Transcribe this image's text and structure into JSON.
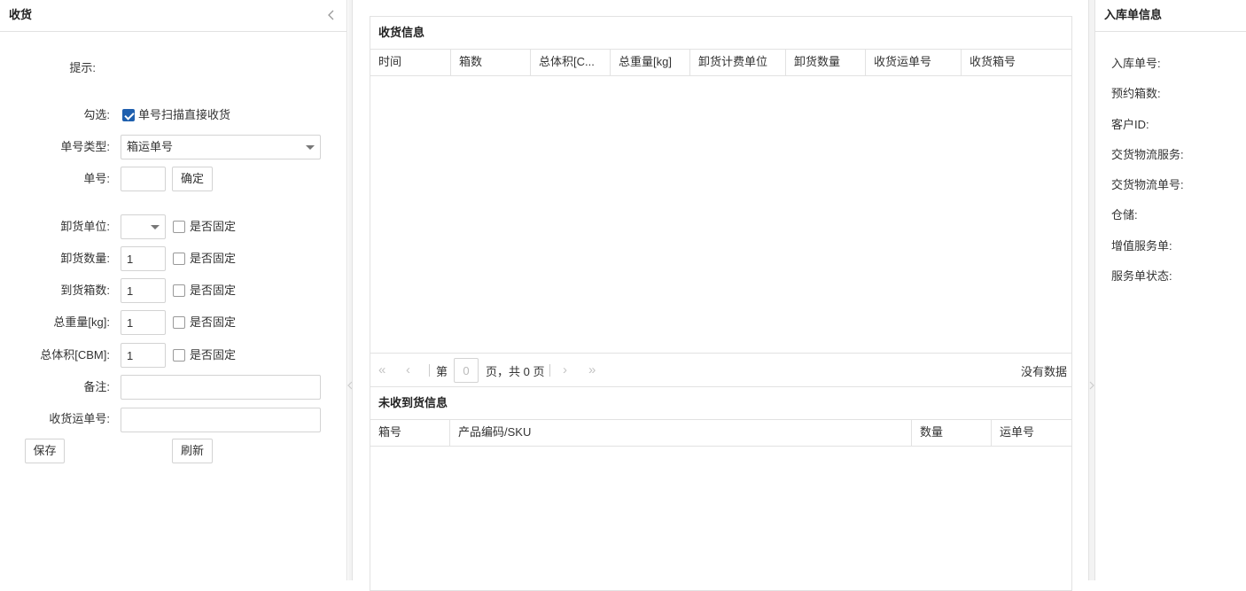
{
  "left": {
    "title": "收货",
    "hint_label": "提示:",
    "check_label": "勾选:",
    "scan_direct_label": "单号扫描直接收货",
    "scan_direct_checked": true,
    "type_label": "单号类型:",
    "type_value": "箱运单号",
    "number_label": "单号:",
    "number_value": "",
    "confirm_btn": "确定",
    "unload_unit_label": "卸货单位:",
    "unload_qty_label": "卸货数量:",
    "unload_qty_value": "1",
    "arrive_box_label": "到货箱数:",
    "arrive_box_value": "1",
    "weight_label": "总重量[kg]:",
    "weight_value": "1",
    "volume_label": "总体积[CBM]:",
    "volume_value": "1",
    "fixed_label": "是否固定",
    "remark_label": "备注:",
    "remark_value": "",
    "waybill_label": "收货运单号:",
    "waybill_value": "",
    "save_btn": "保存",
    "refresh_btn": "刷新"
  },
  "center": {
    "received": {
      "title": "收货信息",
      "columns": [
        "时间",
        "箱数",
        "总体积[C...",
        "总重量[kg]",
        "卸货计费单位",
        "卸货数量",
        "收货运单号",
        "收货箱号"
      ]
    },
    "pager": {
      "page_prefix": "第",
      "page_value": "0",
      "page_suffix": "页，共 0 页",
      "no_data": "没有数据"
    },
    "unreceived": {
      "title": "未收到货信息",
      "columns": [
        "箱号",
        "产品编码/SKU",
        "数量",
        "运单号"
      ]
    }
  },
  "right": {
    "title": "入库单信息",
    "fields": [
      "入库单号:",
      "预约箱数:",
      "客户ID:",
      "交货物流服务:",
      "交货物流单号:",
      "仓储:",
      "增值服务单:",
      "服务单状态:"
    ]
  },
  "colors": {
    "border": "#e2e2e2",
    "checkbox_on": "#1e5fae",
    "background": "#f3f3f3"
  }
}
